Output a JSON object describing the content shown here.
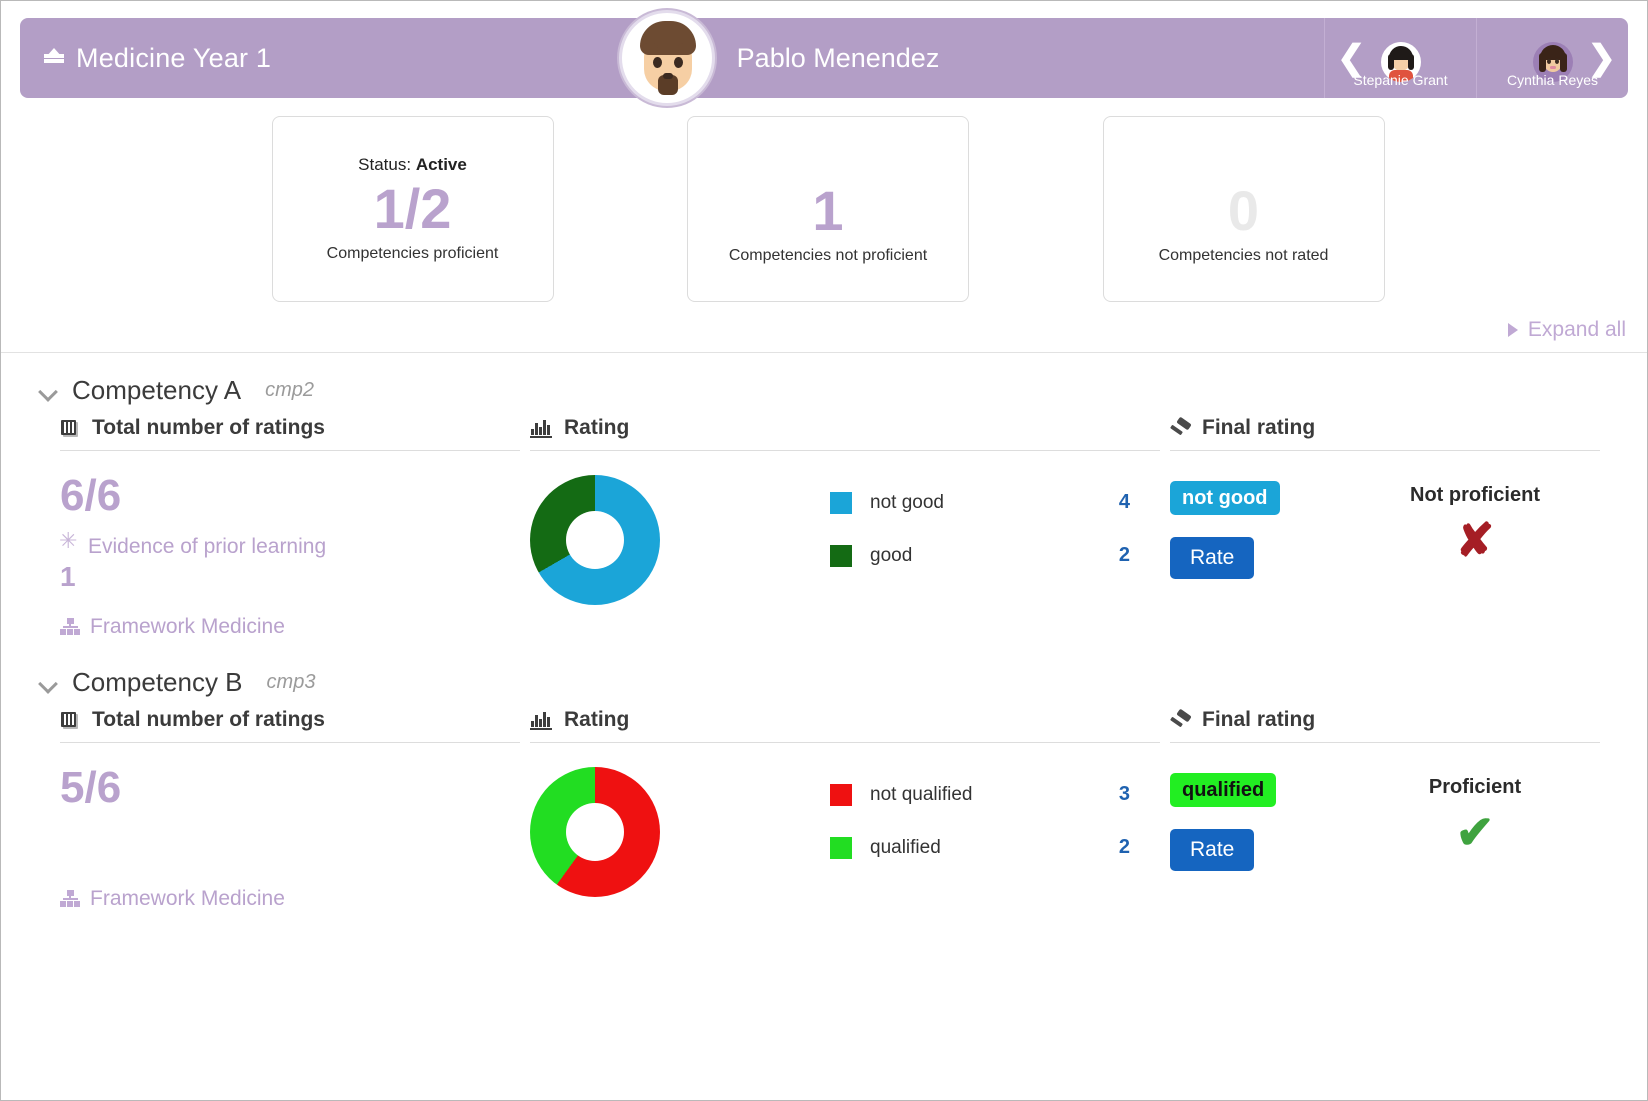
{
  "header": {
    "course_title": "Medicine Year 1",
    "course_icon": "graduation-cap-icon",
    "student_name": "Pablo Menendez",
    "prev_student": "Stepanie Grant",
    "next_student": "Cynthia Reyes",
    "prev_arrow": "❮",
    "next_arrow": "❯",
    "bar_color": "#b39ec6"
  },
  "stats": {
    "status_label": "Status:",
    "status_value": "Active",
    "cards": [
      {
        "value": "1/2",
        "caption": "Competencies proficient",
        "muted": false
      },
      {
        "value": "1",
        "caption": "Competencies not proficient",
        "muted": false
      },
      {
        "value": "0",
        "caption": "Competencies not rated",
        "muted": true
      }
    ]
  },
  "toolbar": {
    "expand_all": "Expand all"
  },
  "competencies": [
    {
      "title": "Competency A",
      "code": "cmp2",
      "ratings": {
        "panel_title": "Total number of ratings",
        "value": "6/6",
        "evidence_label": "Evidence of prior learning",
        "evidence_value": "1",
        "framework_label": "Framework Medicine"
      },
      "rating": {
        "panel_title": "Rating",
        "legend": [
          {
            "label": "not good",
            "count": "4",
            "color": "#1ba5d8"
          },
          {
            "label": "good",
            "count": "2",
            "color": "#146b14"
          }
        ]
      },
      "final": {
        "panel_title": "Final rating",
        "badge_text": "not good",
        "badge_bg": "#1ba5d8",
        "badge_fg": "#ffffff",
        "rate_label": "Rate",
        "verdict": "Not proficient",
        "mark": "✘",
        "mark_color": "#a51e25"
      }
    },
    {
      "title": "Competency B",
      "code": "cmp3",
      "ratings": {
        "panel_title": "Total number of ratings",
        "value": "5/6",
        "evidence_label": "",
        "evidence_value": "",
        "framework_label": "Framework Medicine"
      },
      "rating": {
        "panel_title": "Rating",
        "legend": [
          {
            "label": "not qualified",
            "count": "3",
            "color": "#ef1111"
          },
          {
            "label": "qualified",
            "count": "2",
            "color": "#22dd22"
          }
        ]
      },
      "final": {
        "panel_title": "Final rating",
        "badge_text": "qualified",
        "badge_bg": "#22ee22",
        "badge_fg": "#111111",
        "rate_label": "Rate",
        "verdict": "Proficient",
        "mark": "✔",
        "mark_color": "#3fa33f"
      }
    }
  ],
  "chart_data": [
    {
      "type": "pie",
      "title": "Rating — Competency A",
      "categories": [
        "not good",
        "good"
      ],
      "values": [
        4,
        2
      ],
      "colors": [
        "#1ba5d8",
        "#146b14"
      ],
      "total": 6,
      "legend": "right",
      "donut": true
    },
    {
      "type": "pie",
      "title": "Rating — Competency B",
      "categories": [
        "not qualified",
        "qualified"
      ],
      "values": [
        3,
        2
      ],
      "colors": [
        "#ef1111",
        "#22dd22"
      ],
      "total": 5,
      "legend": "right",
      "donut": true
    }
  ]
}
